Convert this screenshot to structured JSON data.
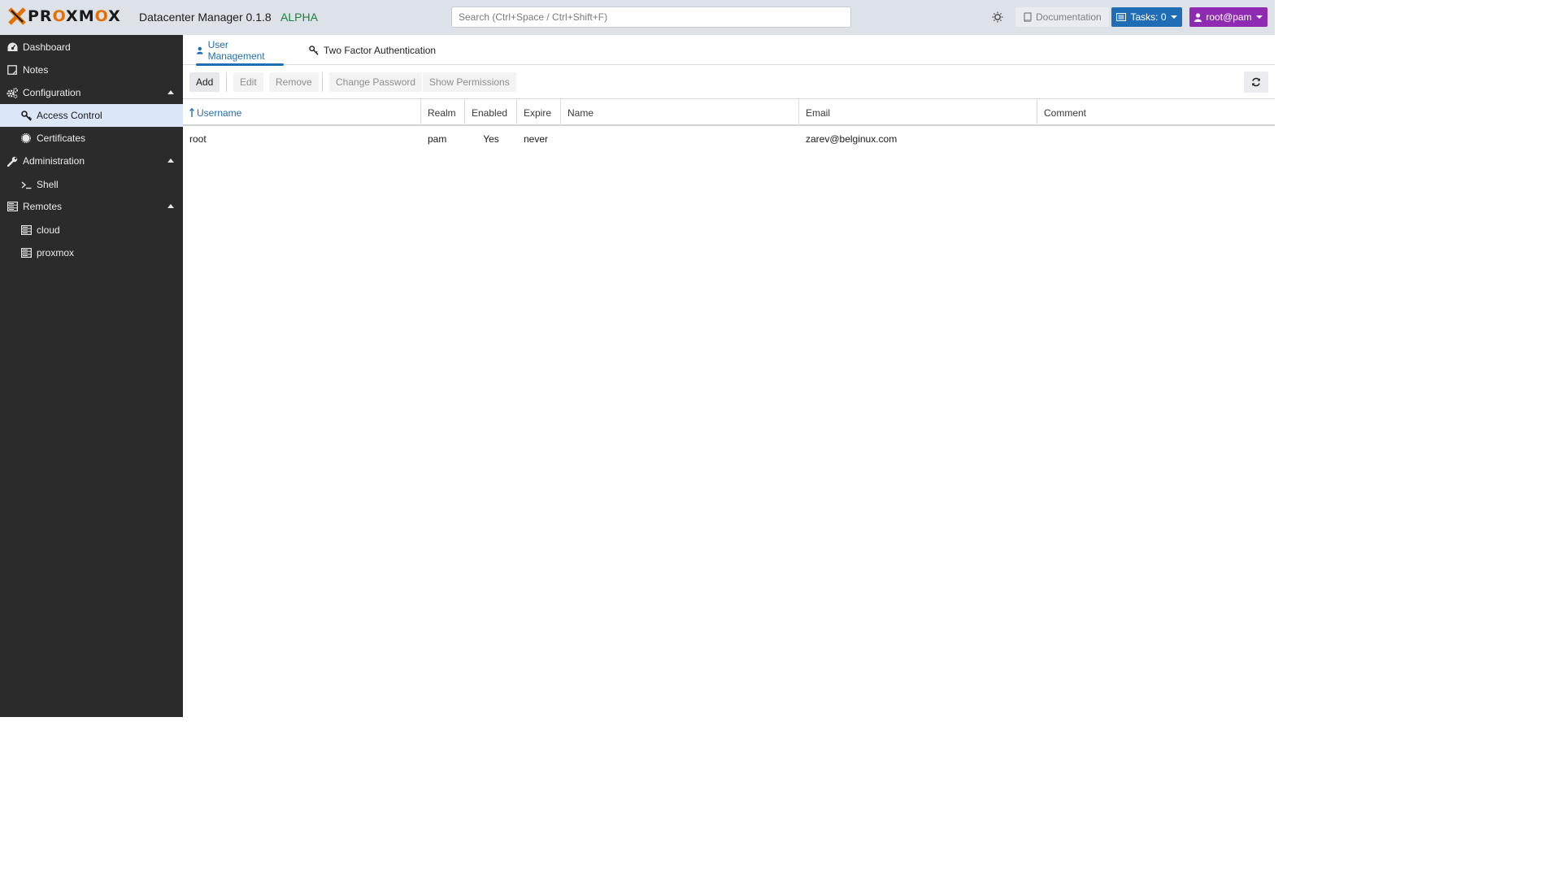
{
  "header": {
    "logo_text_a": "PR",
    "logo_text_o1": "O",
    "logo_text_b": "XM",
    "logo_text_o2": "O",
    "logo_text_c": "X",
    "app_title": "Datacenter Manager 0.1.8",
    "app_badge": "ALPHA",
    "search_placeholder": "Search (Ctrl+Space / Ctrl+Shift+F)",
    "documentation_label": "Documentation",
    "tasks_label": "Tasks: 0",
    "user_label": "root@pam"
  },
  "sidebar": {
    "items": [
      {
        "label": "Dashboard",
        "icon": "dashboard-icon"
      },
      {
        "label": "Notes",
        "icon": "notes-icon"
      },
      {
        "label": "Configuration",
        "icon": "cogs-icon"
      },
      {
        "label": "Access Control",
        "icon": "key-icon"
      },
      {
        "label": "Certificates",
        "icon": "certificate-icon"
      },
      {
        "label": "Administration",
        "icon": "wrench-icon"
      },
      {
        "label": "Shell",
        "icon": "terminal-icon"
      },
      {
        "label": "Remotes",
        "icon": "server-icon"
      },
      {
        "label": "cloud",
        "icon": "server-icon"
      },
      {
        "label": "proxmox",
        "icon": "server-icon"
      }
    ]
  },
  "tabs": [
    {
      "label": "User Management",
      "icon": "user-icon"
    },
    {
      "label": "Two Factor Authentication",
      "icon": "key-icon"
    }
  ],
  "toolbar": {
    "add": "Add",
    "edit": "Edit",
    "remove": "Remove",
    "change_password": "Change Password",
    "show_permissions": "Show Permissions"
  },
  "grid": {
    "columns": [
      "Username",
      "Realm",
      "Enabled",
      "Expire",
      "Name",
      "Email",
      "Comment"
    ],
    "rows": [
      {
        "username": "root",
        "realm": "pam",
        "enabled": "Yes",
        "expire": "never",
        "name": "",
        "email": "zarev@belginux.com",
        "comment": ""
      }
    ]
  },
  "colors": {
    "accent": "#1f6db5",
    "user_button": "#8f2bb3",
    "alpha_badge": "#18823a",
    "logo_orange": "#e57000",
    "sidebar_bg": "#2b2b2b"
  }
}
